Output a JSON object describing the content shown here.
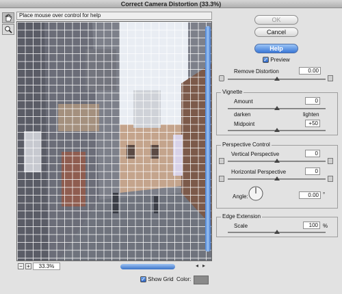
{
  "window": {
    "title": "Correct Camera Distortion (33.3%)"
  },
  "help_text": "Place mouse over control for help",
  "tools": [
    {
      "icon": "hand-icon"
    },
    {
      "icon": "zoom-icon"
    }
  ],
  "buttons": {
    "ok": "OK",
    "cancel": "Cancel",
    "help": "Help"
  },
  "preview": {
    "label": "Preview",
    "checked": true
  },
  "remove_distortion": {
    "label": "Remove Distortion",
    "value": "0.00",
    "level": 0.5
  },
  "vignette": {
    "title": "Vignette",
    "amount_label": "Amount",
    "amount_value": "0",
    "amount_level": 0.5,
    "darken": "darken",
    "lighten": "lighten",
    "midpoint_label": "Midpoint",
    "midpoint_value": "+50",
    "midpoint_level": 0.5
  },
  "perspective": {
    "title": "Perspective Control",
    "vertical_label": "Vertical Perspective",
    "vertical_value": "0",
    "vertical_level": 0.5,
    "horizontal_label": "Horizontal Perspective",
    "horizontal_value": "0",
    "horizontal_level": 0.5,
    "angle_label": "Angle:",
    "angle_value": "0.00",
    "angle_unit": "°"
  },
  "edge": {
    "title": "Edge Extension",
    "scale_label": "Scale",
    "scale_value": "100",
    "scale_unit": "%",
    "scale_level": 0.5
  },
  "zoom": {
    "value": "33.3%",
    "minus": "−",
    "plus": "+"
  },
  "show_grid": {
    "label": "Show Grid",
    "checked": true
  },
  "color": {
    "label": "Color:",
    "swatch": "#8a8a8a"
  }
}
